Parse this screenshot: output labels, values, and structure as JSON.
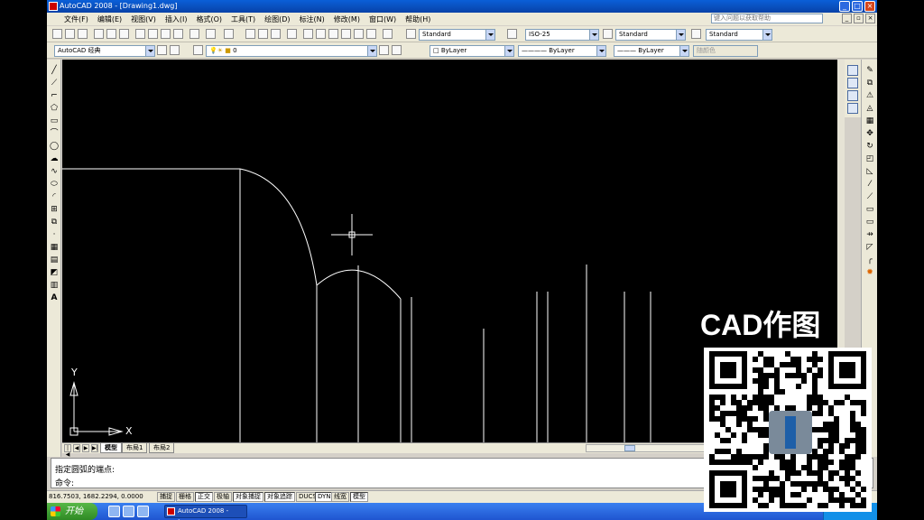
{
  "window": {
    "title": "AutoCAD 2008 - [Drawing1.dwg]",
    "controls": [
      "_",
      "□",
      "×"
    ]
  },
  "menu": {
    "items": [
      "文件(F)",
      "编辑(E)",
      "视图(V)",
      "插入(I)",
      "格式(O)",
      "工具(T)",
      "绘图(D)",
      "标注(N)",
      "修改(M)",
      "窗口(W)",
      "帮助(H)"
    ],
    "help_search_placeholder": "键入问题以获取帮助"
  },
  "styles_toolbar": {
    "text_style": "Standard",
    "dim_style": "ISO-25",
    "table_style": "Standard",
    "multileader_style": "Standard"
  },
  "workspace_toolbar": {
    "workspace": "AutoCAD 经典",
    "layer": "0",
    "color": "ByLayer",
    "linetype": "ByLayer",
    "lineweight": "ByLayer",
    "plot_style": "随颜色"
  },
  "draw_tools": [
    "line-icon",
    "xline-icon",
    "polyline-icon",
    "polygon-icon",
    "rectangle-icon",
    "arc-icon",
    "circle-icon",
    "revcloud-icon",
    "spline-icon",
    "ellipse-icon",
    "ellipse-arc-icon",
    "insert-block-icon",
    "make-block-icon",
    "point-icon",
    "hatch-icon",
    "gradient-icon",
    "region-icon",
    "table-icon",
    "mtext-icon"
  ],
  "modify_tools": [
    "erase-icon",
    "copy-icon",
    "mirror-icon",
    "offset-icon",
    "array-icon",
    "move-icon",
    "rotate-icon",
    "scale-icon",
    "stretch-icon",
    "trim-icon",
    "extend-icon",
    "break-point-icon",
    "break-icon",
    "join-icon",
    "chamfer-icon",
    "fillet-icon",
    "explode-icon"
  ],
  "mtext_glyph": "A",
  "ucs": {
    "x_label": "X",
    "y_label": "Y"
  },
  "layout_tabs": [
    "模型",
    "布局1",
    "布局2"
  ],
  "active_tab": "模型",
  "command_line": {
    "history": "指定圆弧的端点:",
    "prompt": "命令:"
  },
  "status_bar": {
    "coordinates": "816.7503, 1682.2294, 0.0000",
    "toggles": [
      {
        "label": "捕捉",
        "on": false
      },
      {
        "label": "栅格",
        "on": false
      },
      {
        "label": "正交",
        "on": true
      },
      {
        "label": "极轴",
        "on": false
      },
      {
        "label": "对象捕捉",
        "on": true
      },
      {
        "label": "对象追踪",
        "on": true
      },
      {
        "label": "DUCS",
        "on": false
      },
      {
        "label": "DYN",
        "on": true
      },
      {
        "label": "线宽",
        "on": false
      },
      {
        "label": "模型",
        "on": true
      }
    ]
  },
  "taskbar": {
    "start_label": "开始",
    "task_label": "AutoCAD 2008 - [Dra..."
  },
  "watermark": {
    "text": "CAD作图"
  },
  "colors": {
    "canvas": "#000000",
    "drawing_lines": "#ffffff",
    "title_bar": "#0a5fd8",
    "taskbar": "#1f55d0"
  }
}
